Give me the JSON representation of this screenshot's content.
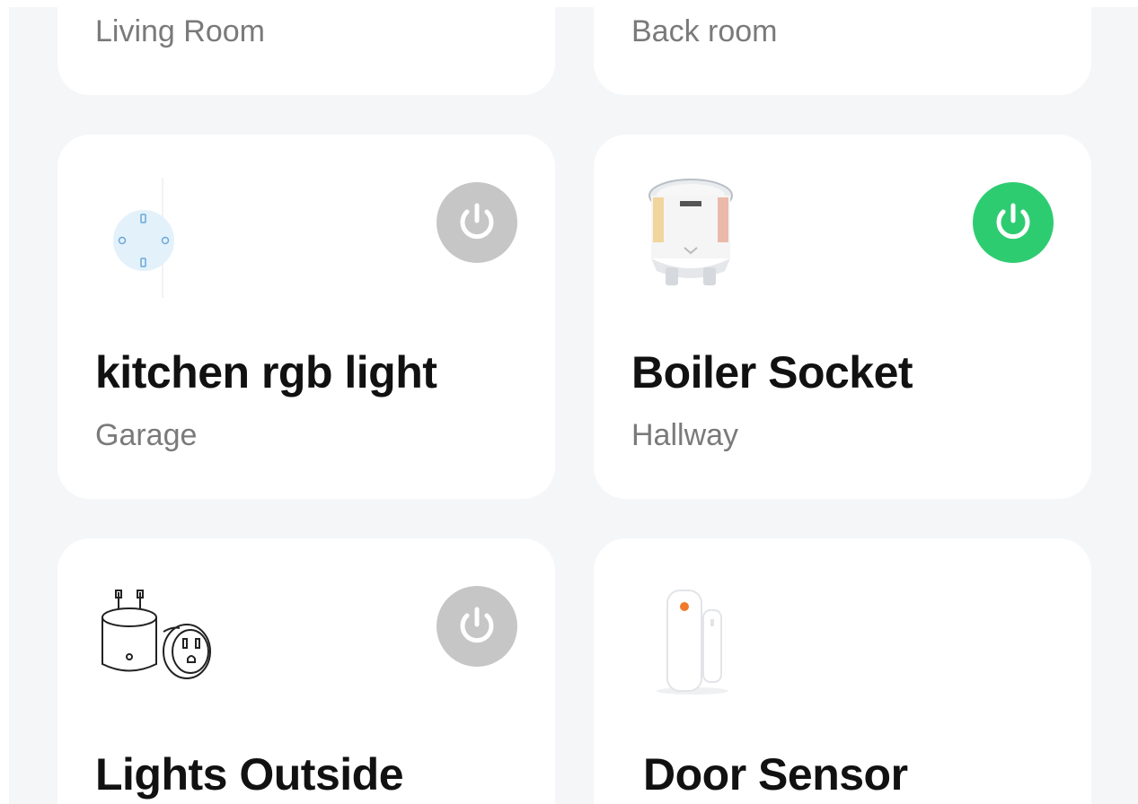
{
  "devices": [
    {
      "name": "",
      "room": "Living Room",
      "power": null
    },
    {
      "name": "",
      "room": "Back room",
      "power": null
    },
    {
      "name": "kitchen rgb light",
      "room": "Garage",
      "power": "off",
      "icon": "smart-plug-outline-icon"
    },
    {
      "name": "Boiler Socket",
      "room": "Hallway",
      "power": "on",
      "icon": "smart-socket-photo-icon"
    },
    {
      "name": "Lights Outside",
      "room": "",
      "power": "off",
      "icon": "plug-adapter-drawing-icon"
    },
    {
      "name": "Door Sensor",
      "room": "",
      "power": null,
      "icon": "door-sensor-icon"
    }
  ],
  "colors": {
    "background": "#f4f6f8",
    "card": "#ffffff",
    "power_on": "#2ecc71",
    "power_off": "#c6c6c6",
    "name_text": "#111111",
    "room_text": "#7a7a7a"
  }
}
